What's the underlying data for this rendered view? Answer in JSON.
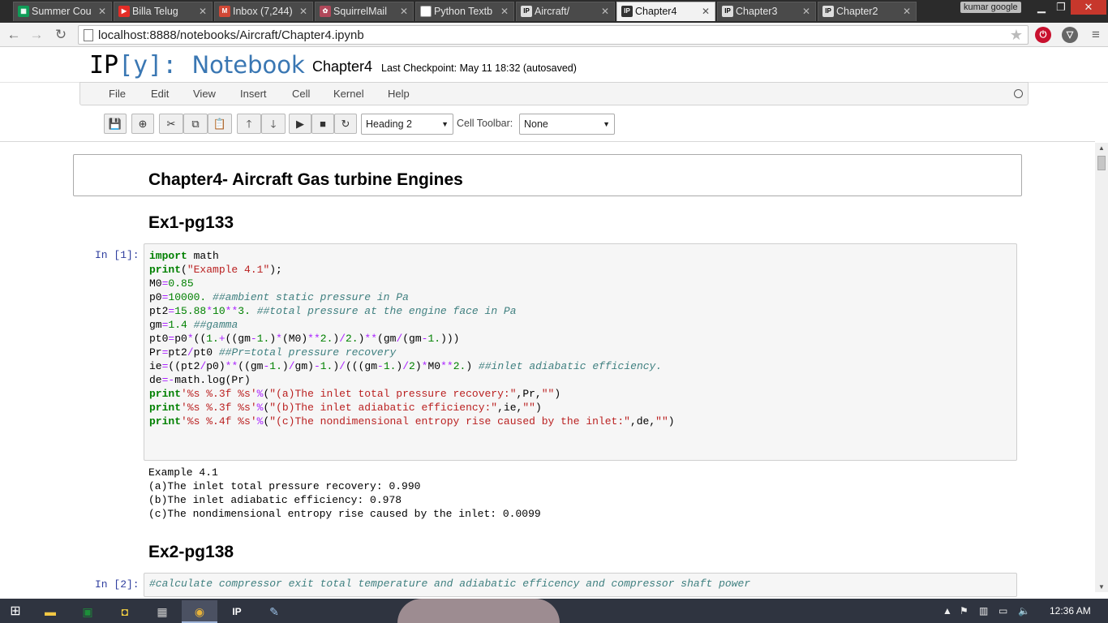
{
  "browser": {
    "tabs": [
      {
        "label": "Summer Cou",
        "icon": "sheets-icon",
        "color": "#0f9d58"
      },
      {
        "label": "Billa Telug",
        "icon": "youtube-icon",
        "color": "#e52d27"
      },
      {
        "label": "Inbox (7,244)",
        "icon": "gmail-icon",
        "color": "#d14836"
      },
      {
        "label": "SquirrelMail",
        "icon": "squirrelmail-icon",
        "color": "#b0485a"
      },
      {
        "label": "Python Textb",
        "icon": "page-icon",
        "color": "#dddddd"
      },
      {
        "label": "Aircraft/",
        "icon": "ipython-icon",
        "color": "#dddddd"
      },
      {
        "label": "Chapter4",
        "icon": "ipython-icon",
        "color": "#dddddd"
      },
      {
        "label": "Chapter3",
        "icon": "ipython-icon",
        "color": "#dddddd"
      },
      {
        "label": "Chapter2",
        "icon": "ipython-icon",
        "color": "#dddddd"
      }
    ],
    "profile_name": "kumar google",
    "url": "localhost:8888/notebooks/Aircraft/Chapter4.ipynb"
  },
  "notebook": {
    "logo_ip": "IP",
    "logo_bracket": "[y]:",
    "logo_notebook": "Notebook",
    "name": "Chapter4",
    "checkpoint": "Last Checkpoint: May 11 18:32 (autosaved)",
    "menu": [
      "File",
      "Edit",
      "View",
      "Insert",
      "Cell",
      "Kernel",
      "Help"
    ],
    "cell_type": "Heading 2",
    "cell_toolbar_label": "Cell Toolbar:",
    "cell_toolbar_value": "None"
  },
  "content": {
    "heading1": "Chapter4- Aircraft Gas turbine Engines",
    "ex1_heading": "Ex1-pg133",
    "cell1_prompt": "In [1]:",
    "output_lines": [
      "Example 4.1",
      "(a)The inlet total pressure recovery: 0.990",
      "(b)The inlet adiabatic efficiency: 0.978",
      "(c)The nondimensional entropy rise caused by the inlet: 0.0099"
    ],
    "ex2_heading": "Ex2-pg138",
    "cell2_prompt": "In [2]:",
    "cell2_code": "#calculate compressor exit total temperature and adiabatic efficency and compressor shaft power"
  },
  "taskbar": {
    "time": "12:36 AM"
  }
}
